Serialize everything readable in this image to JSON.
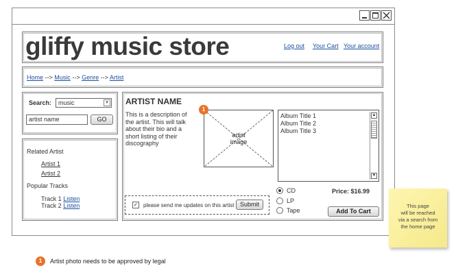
{
  "window": {
    "controls": [
      "minimize",
      "maximize",
      "close"
    ]
  },
  "header": {
    "title": "gliffy music store",
    "links": [
      "Log out",
      "Your Cart",
      "Your account"
    ]
  },
  "breadcrumb": {
    "items": [
      "Home",
      "Music",
      "Genre",
      "Artist"
    ],
    "separator": "-->"
  },
  "search": {
    "label": "Search:",
    "category": "music",
    "query": "artist name",
    "button": "GO"
  },
  "related": {
    "heading": "Related Artist",
    "artists": [
      "Artist 1",
      "Artist 2"
    ],
    "tracks_heading": "Popular Tracks",
    "tracks": [
      {
        "name": "Track 1",
        "link": "Listen"
      },
      {
        "name": "Track 2",
        "link": "Listen"
      }
    ]
  },
  "artist": {
    "name": "ARTIST NAME",
    "description": [
      "This is a description of",
      "the artist.  This will talk",
      "about their bio and a",
      "short listing of their",
      "discography"
    ],
    "image_label": [
      "artist",
      "image"
    ]
  },
  "albums": [
    "Album Title 1",
    "Album Title 2",
    "Album Title 3"
  ],
  "formats": {
    "options": [
      "CD",
      "LP",
      "Tape"
    ],
    "selected": "CD"
  },
  "price": "Price: $16.99",
  "add_to_cart": "Add To Cart",
  "updates": {
    "label": "please send me updates on this artist",
    "checked": true,
    "submit": "Submit"
  },
  "sticky_note": [
    "This page",
    "will be reached",
    "via a search from",
    "the home page"
  ],
  "annotation": {
    "number": "1",
    "text": "Artist photo needs to be approved by legal"
  },
  "colors": {
    "link": "#1a4fa0",
    "marker": "#e8732a",
    "sticky": "#fbf3a0"
  }
}
